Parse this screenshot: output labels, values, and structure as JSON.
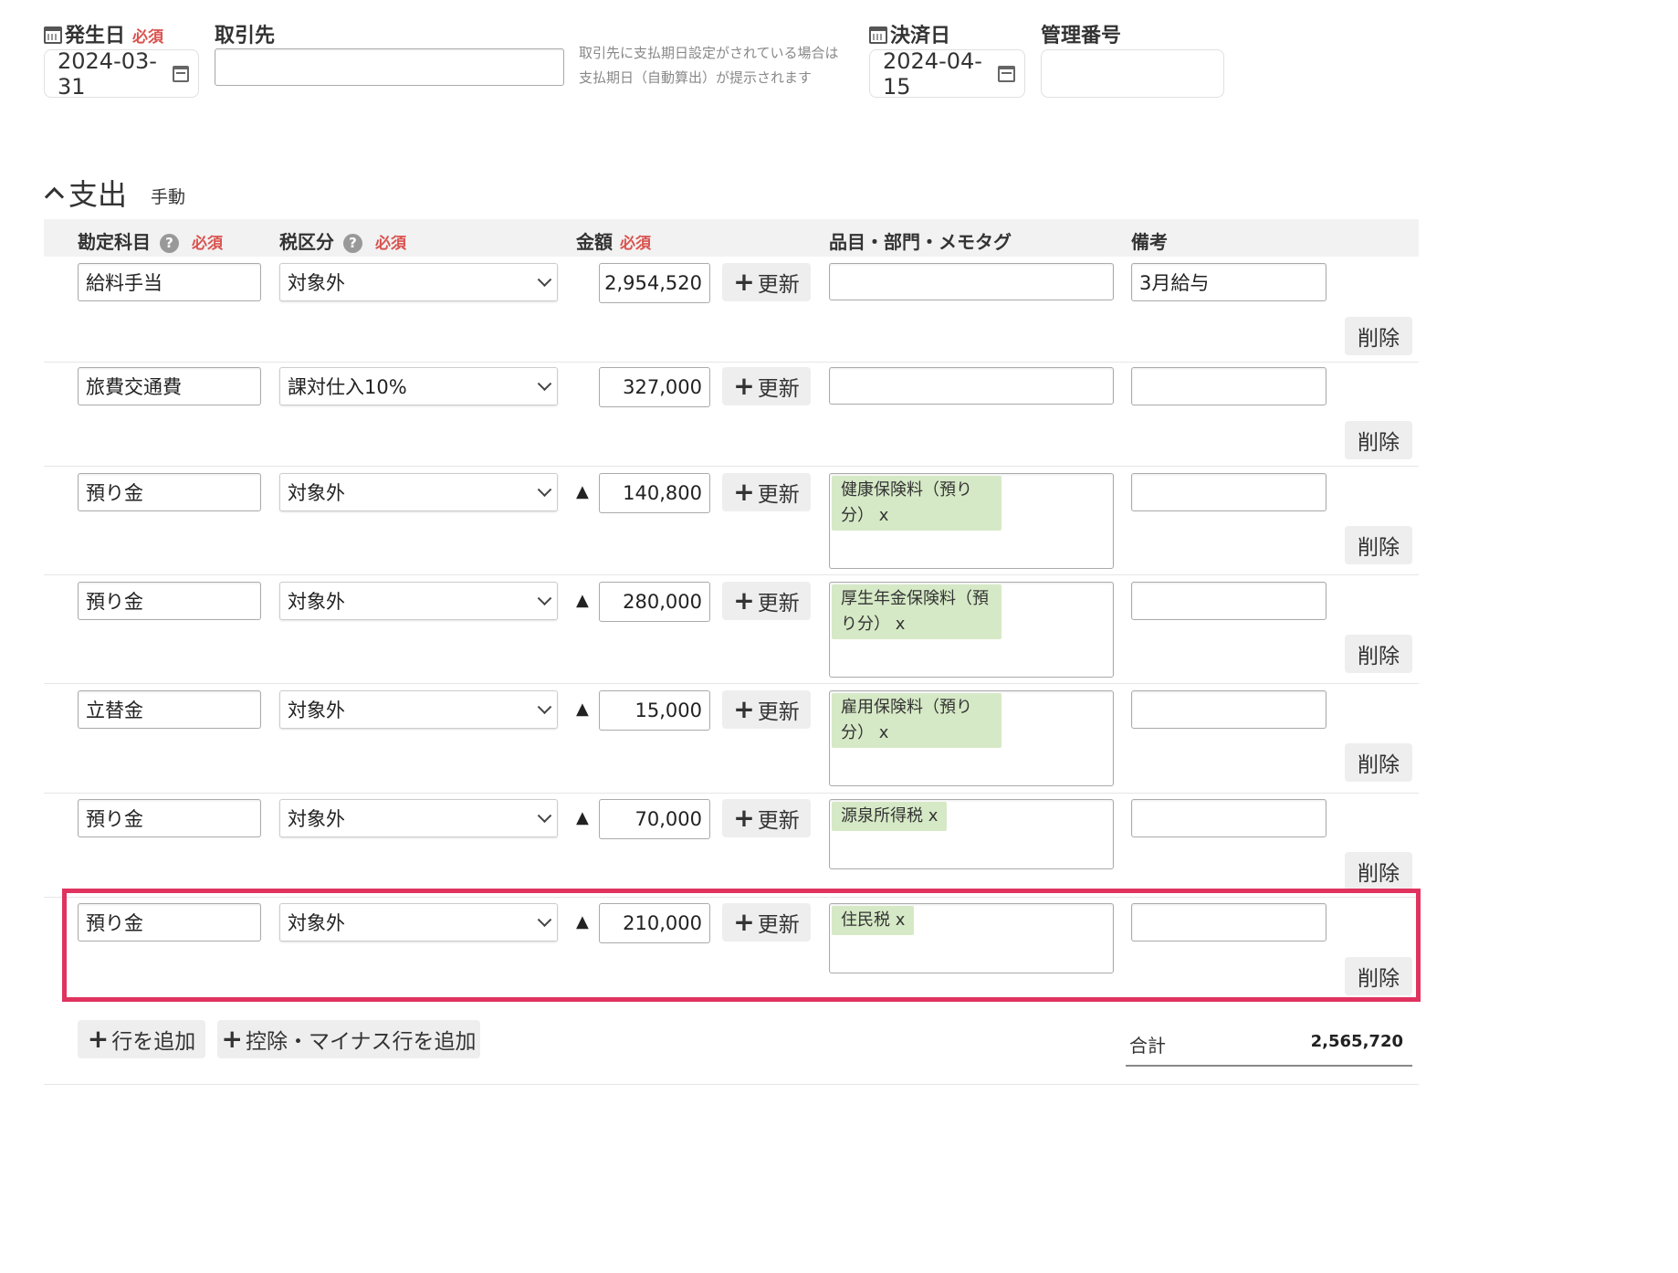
{
  "header": {
    "occurrence_date_label": "発生日",
    "required_label": "必須",
    "occurrence_date_value": "2024-03-31",
    "partner_label": "取引先",
    "partner_value": "",
    "partner_note_line1": "取引先に支払期日設定がされている場合は",
    "partner_note_line2": "支払期日（自動算出）が提示されます",
    "settlement_date_label": "決済日",
    "settlement_date_value": "2024-04-15",
    "management_no_label": "管理番号",
    "management_no_value": ""
  },
  "section": {
    "title": "支出",
    "mode": "手動"
  },
  "columns": {
    "account": "勘定科目",
    "tax": "税区分",
    "amount": "金額",
    "tags": "品目・部門・メモタグ",
    "remarks": "備考",
    "required": "必須",
    "help": "?"
  },
  "row_labels": {
    "update": "更新",
    "delete": "削除",
    "tag_remove": "x",
    "minus_mark": "▲"
  },
  "rows": [
    {
      "account": "給料手当",
      "tax": "対象外",
      "minus": "",
      "amount": "2,954,520",
      "tags": [],
      "remarks": "3月給与"
    },
    {
      "account": "旅費交通費",
      "tax": "課対仕入10%",
      "minus": "",
      "amount": "327,000",
      "tags": [],
      "remarks": ""
    },
    {
      "account": "預り金",
      "tax": "対象外",
      "minus": "▲",
      "amount": "140,800",
      "tags": [
        "健康保険料（預り分）"
      ],
      "remarks": ""
    },
    {
      "account": "預り金",
      "tax": "対象外",
      "minus": "▲",
      "amount": "280,000",
      "tags": [
        "厚生年金保険料（預り分）"
      ],
      "remarks": ""
    },
    {
      "account": "立替金",
      "tax": "対象外",
      "minus": "▲",
      "amount": "15,000",
      "tags": [
        "雇用保険料（預り分）"
      ],
      "remarks": ""
    },
    {
      "account": "預り金",
      "tax": "対象外",
      "minus": "▲",
      "amount": "70,000",
      "tags": [
        "源泉所得税"
      ],
      "remarks": ""
    },
    {
      "account": "預り金",
      "tax": "対象外",
      "minus": "▲",
      "amount": "210,000",
      "tags": [
        "住民税"
      ],
      "remarks": ""
    }
  ],
  "footer": {
    "add_row": "行を追加",
    "add_minus_row": "控除・マイナス行を追加",
    "total_label": "合計",
    "total_value": "2,565,720"
  },
  "highlight_color": "#e0335f"
}
